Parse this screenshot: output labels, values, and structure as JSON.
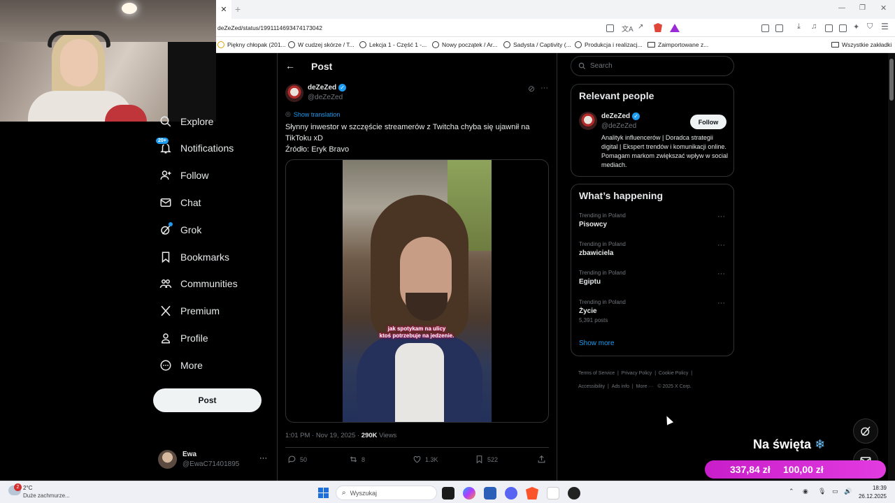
{
  "browser": {
    "url": "deZeZed/status/1991114693474173042",
    "bookmarks": [
      "Piękny chłopak (201...",
      "W cudzej skórze / T...",
      "Lekcja 1 - Część 1 -...",
      "Nowy początek / Ar...",
      "Sadysta / Captivity (...",
      "Produkcja i realizacj...",
      "Zaimportowane z...",
      "Wszystkie zakładki"
    ]
  },
  "nav": {
    "items": [
      {
        "label": "Explore"
      },
      {
        "label": "Notifications",
        "badge": "20+"
      },
      {
        "label": "Follow"
      },
      {
        "label": "Chat"
      },
      {
        "label": "Grok"
      },
      {
        "label": "Bookmarks"
      },
      {
        "label": "Communities"
      },
      {
        "label": "Premium"
      },
      {
        "label": "Profile"
      },
      {
        "label": "More"
      }
    ],
    "post_button": "Post",
    "account": {
      "name": "Ewa",
      "handle": "@EwaC71401895"
    }
  },
  "post": {
    "header_title": "Post",
    "author_name": "deZeZed",
    "author_handle": "@deZeZed",
    "show_translation": "Show translation",
    "text_line1": "Słynny inwestor w szczęście streamerów z Twitcha chyba się ujawnił na",
    "text_line2": "TikToku xD",
    "text_line3": "Źródło: Eryk Bravo",
    "video_caption_line1": "jak spotykam na ulicy",
    "video_caption_line2": "ktoś potrzebuje na jedzenie.",
    "timestamp": "1:01 PM · Nov 19, 2025 · ",
    "views_count": "290K",
    "views_label": "Views",
    "stats": {
      "replies": "50",
      "reposts": "8",
      "likes": "1.3K",
      "bookmarks": "522"
    }
  },
  "sidebar": {
    "search_placeholder": "Search",
    "relevant_title": "Relevant people",
    "person": {
      "name": "deZeZed",
      "handle": "@deZeZed",
      "bio": "Analityk influencerów | Doradca strategii digital | Ekspert trendów i komunikacji online. Pomagam markom zwiększać wpływ w social mediach.",
      "follow_label": "Follow"
    },
    "happening_title": "What’s happening",
    "trends": [
      {
        "meta": "Trending in Poland",
        "name": "Pisowcy",
        "posts": ""
      },
      {
        "meta": "Trending in Poland",
        "name": "zbawiciela",
        "posts": ""
      },
      {
        "meta": "Trending in Poland",
        "name": "Egiptu",
        "posts": ""
      },
      {
        "meta": "Trending in Poland",
        "name": "Życie",
        "posts": "5,391 posts"
      }
    ],
    "show_more": "Show more",
    "footer_links": [
      "Terms of Service",
      "Privacy Policy",
      "Cookie Policy",
      "Accessibility",
      "Ads info",
      "More ···",
      "© 2025 X Corp."
    ]
  },
  "overlay": {
    "title": "Na święta",
    "amount_current": "337,84 zł",
    "amount_goal": "100,00 zł"
  },
  "taskbar": {
    "weather_temp": "2°C",
    "weather_desc": "Duże zachmurze...",
    "weather_badge": "2",
    "search_placeholder": "Wyszukaj",
    "time": "18:39",
    "date": "26.12.2025"
  },
  "colors": {
    "accent": "#1d9bf0",
    "overlay_pink": "#d62bd4",
    "background": "#000000"
  }
}
